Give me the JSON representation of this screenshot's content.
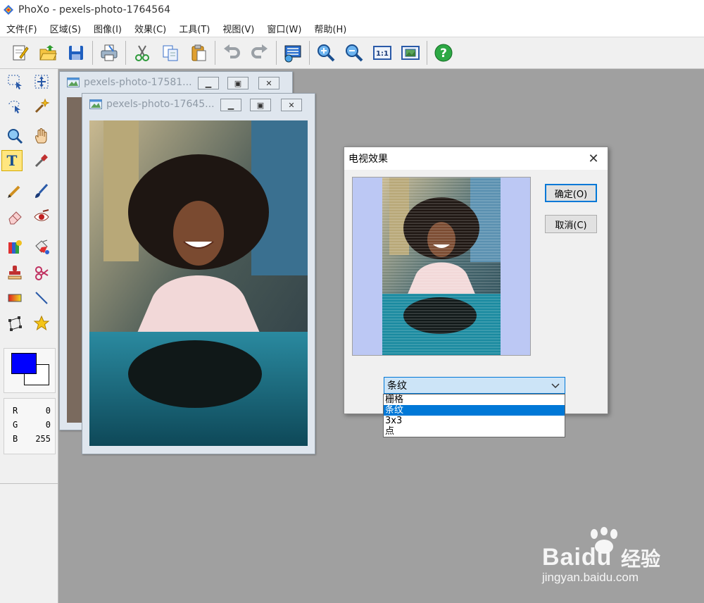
{
  "window": {
    "title": "PhoXo - pexels-photo-1764564"
  },
  "menu": [
    {
      "label": "文件(F)"
    },
    {
      "label": "区域(S)"
    },
    {
      "label": "图像(I)"
    },
    {
      "label": "效果(C)"
    },
    {
      "label": "工具(T)"
    },
    {
      "label": "视图(V)"
    },
    {
      "label": "窗口(W)"
    },
    {
      "label": "帮助(H)"
    }
  ],
  "toolbar": {
    "icons": [
      "new-icon",
      "open-icon",
      "save-icon",
      "print-icon",
      "cut-icon",
      "copy-icon",
      "paste-icon",
      "undo-icon",
      "redo-icon",
      "screen-capture-icon",
      "zoom-in-icon",
      "zoom-out-icon",
      "actual-size-icon",
      "fit-window-icon",
      "help-icon"
    ],
    "actual_size_label": "1:1"
  },
  "tools": [
    "rect-select-icon",
    "move-icon",
    "lasso-icon",
    "magic-wand-icon",
    "zoom-icon",
    "hand-icon",
    "text-icon",
    "eyedropper-icon",
    "pen-icon",
    "brush-icon",
    "eraser-icon",
    "red-eye-icon",
    "fill-icon",
    "paint-bucket-icon",
    "stamp-icon",
    "heal-icon",
    "gradient-icon",
    "line-icon",
    "transform-icon",
    "star-icon"
  ],
  "colors": {
    "foreground": "#0000ff",
    "background": "#ffffff",
    "accent": "#0078d7"
  },
  "rgb": {
    "r_label": "R",
    "r_value": "0",
    "g_label": "G",
    "g_value": "0",
    "b_label": "B",
    "b_value": "255"
  },
  "documents": [
    {
      "title": "pexels-photo-17581..."
    },
    {
      "title": "pexels-photo-17645..."
    }
  ],
  "dialog": {
    "title": "电视效果",
    "ok_label": "确定(O)",
    "cancel_label": "取消(C)",
    "effect_value": "条纹",
    "options": [
      "栅格",
      "条纹",
      "3x3",
      "点"
    ],
    "selected_option": "条纹"
  },
  "watermark": {
    "brand": "Baidu",
    "brand_cn": "经验",
    "url": "jingyan.baidu.com"
  }
}
